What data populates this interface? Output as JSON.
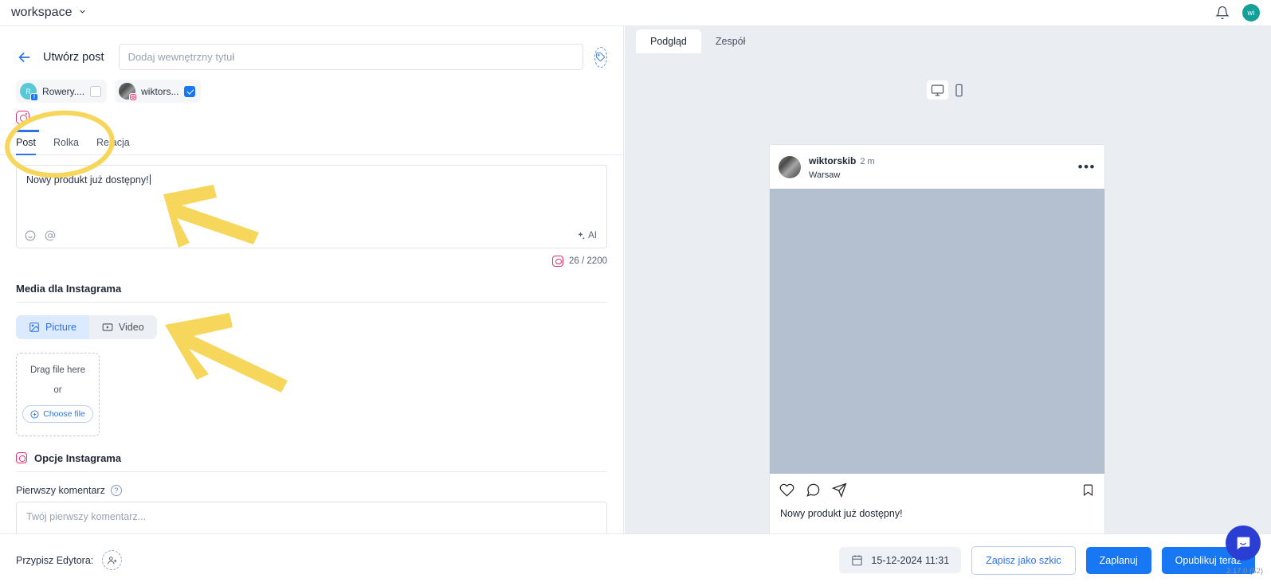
{
  "topbar": {
    "workspace": "workspace",
    "caret": "chevron-down",
    "notifications_icon": "bell-icon",
    "avatar_initials": "wi"
  },
  "editor": {
    "back_icon": "arrow-left-icon",
    "create_post_label": "Utwórz post",
    "title_placeholder": "Dodaj wewnętrzny tytuł",
    "title_value": "",
    "tag_icon": "tag-icon",
    "accounts": [
      {
        "name": "Rowery....",
        "avatar_initial": "R",
        "network": "facebook",
        "checked": false
      },
      {
        "name": "wiktors...",
        "avatar_initial": "",
        "network": "instagram",
        "checked": true
      }
    ],
    "network_icon": "instagram-icon",
    "tabs": [
      {
        "label": "Post",
        "active": true
      },
      {
        "label": "Rolka",
        "active": false
      },
      {
        "label": "Relacja",
        "active": false
      }
    ],
    "content_text": "Nowy produkt już dostępny!",
    "emoji_icon": "emoji-icon",
    "mention_icon": "mention-icon",
    "ai_label": "AI",
    "char_count": "26 / 2200",
    "char_count_icon": "instagram-icon"
  },
  "media": {
    "section_title": "Media dla Instagrama",
    "segments": [
      {
        "label": "Picture",
        "icon": "image-icon",
        "active": true
      },
      {
        "label": "Video",
        "icon": "video-icon",
        "active": false
      }
    ],
    "drop_text": "Drag file here",
    "drop_or": "or",
    "choose_file_label": "Choose file",
    "choose_file_icon": "plus-circle-icon"
  },
  "options": {
    "section_icon": "instagram-icon",
    "section_title": "Opcje Instagrama",
    "first_comment_label": "Pierwszy komentarz",
    "help_icon": "question-icon",
    "first_comment_placeholder": "Twój pierwszy komentarz...",
    "first_comment_value": ""
  },
  "preview": {
    "tabs": [
      {
        "label": "Podgląd",
        "active": true
      },
      {
        "label": "Zespół",
        "active": false
      }
    ],
    "devices": [
      {
        "name": "desktop-icon",
        "active": true
      },
      {
        "name": "mobile-icon",
        "active": false
      }
    ],
    "post": {
      "username": "wiktorskib",
      "time": "2 m",
      "location": "Warsaw",
      "menu_icon": "more-options-icon",
      "actions": [
        "like-icon",
        "comment-icon",
        "share-icon"
      ],
      "save_icon": "bookmark-icon",
      "caption": "Nowy produkt już dostępny!"
    }
  },
  "bottom": {
    "assign_label": "Przypisz Edytora:",
    "assign_icon": "add-user-icon",
    "date_icon": "calendar-icon",
    "date_value": "15-12-2024 11:31",
    "save_draft_label": "Zapisz jako szkic",
    "schedule_label": "Zaplanuj",
    "publish_label": "Opublikuj teraz",
    "support_icon": "chat-bubble-icon",
    "version": "2.17.0 (52)"
  },
  "colors": {
    "primary_blue": "#1877f2",
    "link_blue": "#2f72e8",
    "instagram_pink": "#e1306c",
    "annotation_yellow": "#f7d65c",
    "preview_bg": "#eaeef2",
    "image_placeholder": "#b4c0d0",
    "avatar_teal": "#14a098"
  }
}
